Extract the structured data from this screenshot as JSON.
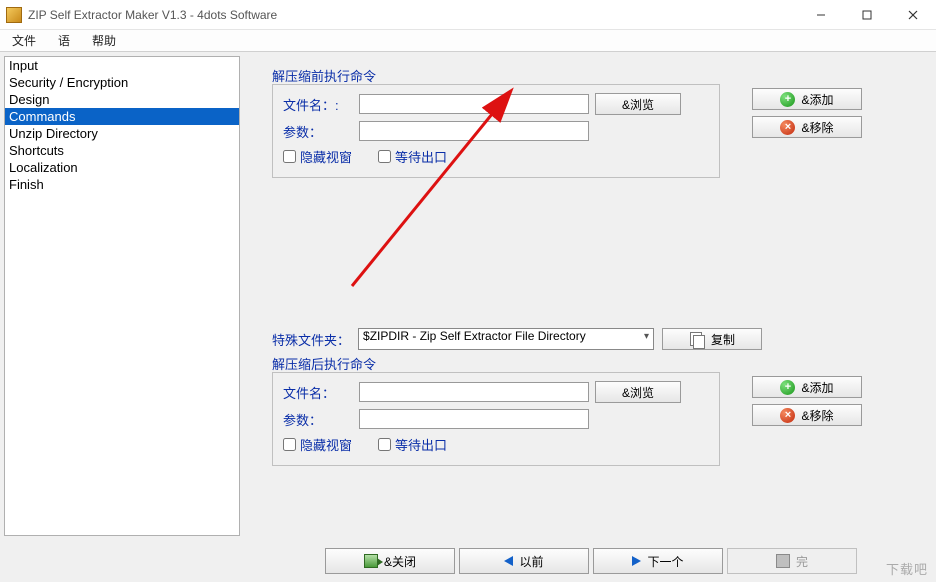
{
  "window": {
    "title": "ZIP Self Extractor Maker V1.3 - 4dots Software"
  },
  "menubar": {
    "file": "文件",
    "language": "语",
    "help": "帮助"
  },
  "sidebar": {
    "items": [
      {
        "label": "Input"
      },
      {
        "label": "Security / Encryption"
      },
      {
        "label": "Design"
      },
      {
        "label": "Commands",
        "selected": true
      },
      {
        "label": "Unzip Directory"
      },
      {
        "label": "Shortcuts"
      },
      {
        "label": "Localization"
      },
      {
        "label": "Finish"
      }
    ]
  },
  "main": {
    "group_before": {
      "title": "解压缩前执行命令",
      "filename_label": "文件名：:",
      "params_label": "参数：",
      "browse": "&浏览",
      "hide_window": "隐藏视窗",
      "wait_exit": "等待出口",
      "add": "&添加",
      "remove": "&移除",
      "filename_value": "",
      "params_value": ""
    },
    "special_folder": {
      "label": "特殊文件夹：",
      "selected": "$ZIPDIR - Zip Self Extractor File Directory",
      "copy": "复制"
    },
    "group_after": {
      "title": "解压缩后执行命令",
      "filename_label": "文件名：",
      "params_label": "参数：",
      "browse": "&浏览",
      "hide_window": "隐藏视窗",
      "wait_exit": "等待出口",
      "add": "&添加",
      "remove": "&移除",
      "filename_value": "",
      "params_value": ""
    }
  },
  "footer": {
    "close": "&关闭",
    "prev": "以前",
    "next": "下一个",
    "finish": "完"
  },
  "watermark": "下载吧"
}
